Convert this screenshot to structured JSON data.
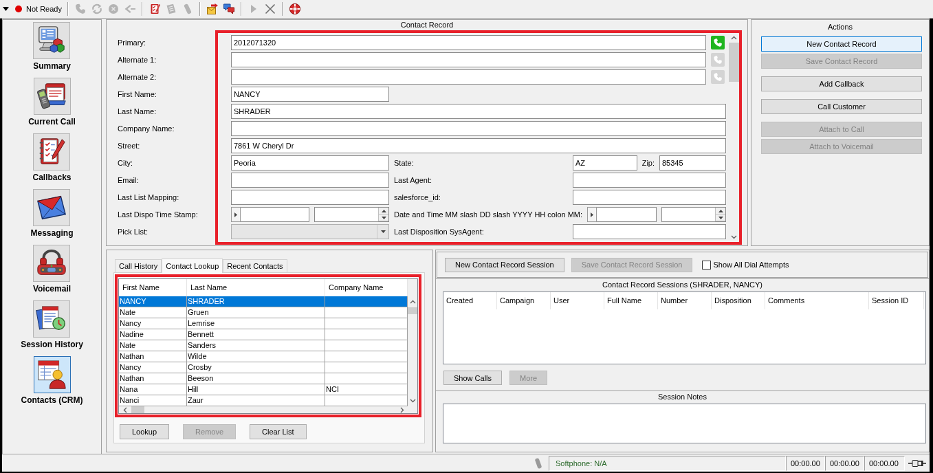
{
  "toolbar": {
    "agent_status": {
      "label": "Not Ready",
      "ready": false
    },
    "tool_groups": [
      [
        {
          "kind": "phone",
          "disabled": true
        },
        {
          "kind": "refresh",
          "disabled": true
        },
        {
          "kind": "stop",
          "disabled": true
        },
        {
          "kind": "back",
          "disabled": true
        }
      ],
      [
        {
          "kind": "notebook",
          "disabled": false
        },
        {
          "kind": "notepad",
          "disabled": true
        },
        {
          "kind": "mobile",
          "disabled": true
        }
      ],
      [
        {
          "kind": "mail",
          "disabled": false
        },
        {
          "kind": "chat",
          "disabled": false
        }
      ],
      [
        {
          "kind": "play",
          "disabled": true
        },
        {
          "kind": "close",
          "disabled": false
        }
      ],
      [
        {
          "kind": "lifebuoy",
          "disabled": false
        }
      ]
    ]
  },
  "sidebar": {
    "items": [
      {
        "label": "Summary",
        "kind": "summary",
        "selected": false
      },
      {
        "label": "Current Call",
        "kind": "call",
        "selected": false
      },
      {
        "label": "Callbacks",
        "kind": "callbacks",
        "selected": false
      },
      {
        "label": "Messaging",
        "kind": "messaging",
        "selected": false
      },
      {
        "label": "Voicemail",
        "kind": "voicemail",
        "selected": false
      },
      {
        "label": "Session History",
        "kind": "history",
        "selected": false
      },
      {
        "label": "Contacts (CRM)",
        "kind": "contacts",
        "selected": true
      }
    ]
  },
  "contact_record": {
    "title": "Contact Record",
    "highlighted": true,
    "rows": [
      {
        "kind": "phone",
        "label": "Primary:",
        "value": "2012071320",
        "dial_enabled": true
      },
      {
        "kind": "phone",
        "label": "Alternate 1:",
        "dial_enabled": false
      },
      {
        "kind": "phone",
        "label": "Alternate 2:",
        "dial_enabled": false
      },
      {
        "kind": "short",
        "label": "First Name:",
        "value": "NANCY"
      },
      {
        "kind": "wide",
        "label": "Last Name:",
        "value": "SHRADER"
      },
      {
        "kind": "wide",
        "label": "Company Name:"
      },
      {
        "kind": "wide",
        "label": "Street:",
        "value": "7861 W Cheryl Dr"
      },
      {
        "kind": "address",
        "label": "City:",
        "value": "Peoria",
        "state_label": "State:",
        "state": "AZ",
        "zip_label": "Zip:",
        "zip": "85345"
      },
      {
        "kind": "split",
        "label": "Email:",
        "right_label": "Last Agent:"
      },
      {
        "kind": "split",
        "label": "Last List Mapping:",
        "right_label": "salesforce_id:"
      },
      {
        "kind": "datetime",
        "label": "Last Dispo Time Stamp:",
        "right_label": "Date and Time MM slash DD slash YYYY HH colon MM:"
      },
      {
        "kind": "picklist",
        "label": "Pick List:",
        "disabled": true,
        "right_label": "Last Disposition SysAgent:"
      }
    ]
  },
  "actions": {
    "title": "Actions",
    "groups": [
      [
        {
          "label": "New Contact Record",
          "disabled": false,
          "focused": true
        },
        {
          "label": "Save Contact Record",
          "disabled": true,
          "focused": false
        }
      ],
      [
        {
          "label": "Add Callback",
          "disabled": false,
          "focused": false
        }
      ],
      [
        {
          "label": "Call Customer",
          "disabled": false,
          "focused": false
        }
      ],
      [
        {
          "label": "Attach to Call",
          "disabled": true,
          "focused": false
        },
        {
          "label": "Attach to Voicemail",
          "disabled": true,
          "focused": false
        }
      ]
    ]
  },
  "lookup": {
    "tabs": [
      {
        "label": "Call History",
        "selected": false
      },
      {
        "label": "Contact Lookup",
        "selected": true
      },
      {
        "label": "Recent Contacts",
        "selected": false
      }
    ],
    "highlighted": true,
    "columns": [
      "First Name",
      "Last Name",
      "Company Name"
    ],
    "rows": [
      {
        "first_name": "NANCY",
        "last_name": "SHRADER",
        "selected": true
      },
      {
        "first_name": "Nate",
        "last_name": "Gruen",
        "selected": false
      },
      {
        "first_name": "Nancy",
        "last_name": "Lemrise",
        "selected": false
      },
      {
        "first_name": "Nadine",
        "last_name": "Bennett",
        "selected": false
      },
      {
        "first_name": "Nate",
        "last_name": "Sanders",
        "selected": false
      },
      {
        "first_name": "Nathan",
        "last_name": "Wilde",
        "selected": false
      },
      {
        "first_name": "Nancy",
        "last_name": "Crosby",
        "selected": false
      },
      {
        "first_name": "Nathan",
        "last_name": "Beeson",
        "selected": false
      },
      {
        "first_name": "Nana",
        "last_name": "Hill",
        "company_name": "NCI",
        "selected": false
      },
      {
        "first_name": "Nanci",
        "last_name": "Zaur",
        "selected": false
      }
    ],
    "buttons": [
      {
        "label": "Lookup",
        "disabled": false
      },
      {
        "label": "Remove",
        "disabled": true
      },
      {
        "label": "Clear List",
        "disabled": false
      }
    ]
  },
  "sessions": {
    "buttons": [
      {
        "label": "New Contact Record Session",
        "disabled": false
      },
      {
        "label": "Save Contact Record Session",
        "disabled": true
      }
    ],
    "checkbox": {
      "label": "Show All Dial Attempts",
      "checked": false
    },
    "title": "Contact Record Sessions (SHRADER, NANCY)",
    "columns": [
      "Created",
      "Campaign",
      "User",
      "Full Name",
      "Number",
      "Disposition",
      "Comments",
      "Session ID"
    ],
    "buttons_below": [
      {
        "label": "Show Calls",
        "disabled": false
      },
      {
        "label": "More",
        "disabled": true
      }
    ]
  },
  "session_notes": {
    "title": "Session Notes"
  },
  "status_bar": {
    "softphone": "Softphone: N/A",
    "timers": [
      "00:00.00",
      "00:00.00",
      "00:00.00"
    ]
  }
}
